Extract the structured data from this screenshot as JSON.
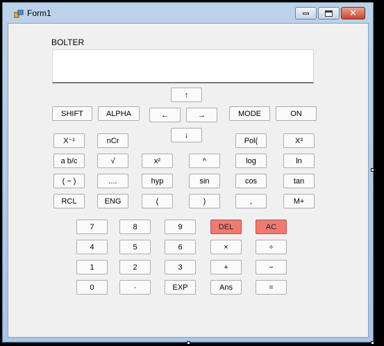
{
  "window": {
    "title": "Form1"
  },
  "display_label": "BOLTER",
  "buttons": {
    "shift": "SHIFT",
    "alpha": "ALPHA",
    "up": "↑",
    "left": "←",
    "right": "→",
    "down": "↓",
    "mode": "MODE",
    "on": "ON",
    "inverse": "X⁻¹",
    "ncr": "nCr",
    "pol": "Pol(",
    "cube": "X³",
    "frac": "a b/c",
    "sqrt": "√",
    "square": "x²",
    "power": "^",
    "log": "log",
    "ln": "ln",
    "neg": "( − )",
    "dots": "....",
    "hyp": "hyp",
    "sin": "sin",
    "cos": "cos",
    "tan": "tan",
    "rcl": "RCL",
    "eng": "ENG",
    "lparen": "(",
    "rparen": ")",
    "comma": ",",
    "mplus": "M+",
    "n7": "7",
    "n8": "8",
    "n9": "9",
    "del": "DEL",
    "ac": "AC",
    "n4": "4",
    "n5": "5",
    "n6": "6",
    "mul": "×",
    "div": "÷",
    "n1": "1",
    "n2": "2",
    "n3": "3",
    "add": "+",
    "sub": "−",
    "n0": "0",
    "dot": "·",
    "exp": "EXP",
    "ans": "Ans",
    "eq": "="
  },
  "colors": {
    "danger": "#f07a72",
    "form_bg": "#f0f0f0",
    "frame": "#bcd2ea"
  }
}
